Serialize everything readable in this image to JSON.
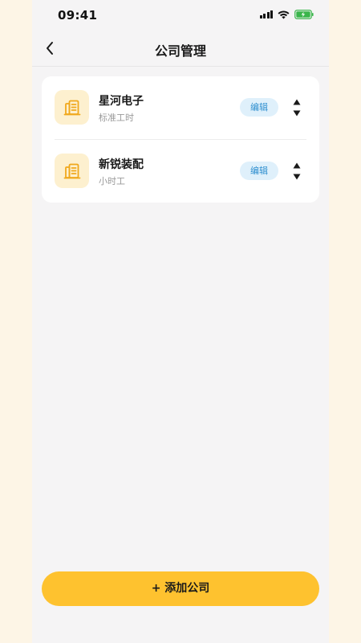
{
  "status_bar": {
    "time": "09:41"
  },
  "header": {
    "title": "公司管理"
  },
  "companies": [
    {
      "name": "星河电子",
      "type": "标准工时",
      "edit_label": "编辑"
    },
    {
      "name": "新锐装配",
      "type": "小时工",
      "edit_label": "编辑"
    }
  ],
  "footer": {
    "add_label": "+ 添加公司"
  },
  "colors": {
    "accent": "#fec22f",
    "icon_bg": "#fdf0cf",
    "icon_color": "#f0a81c",
    "edit_bg": "#dff0fb",
    "edit_text": "#2f8fcf",
    "page_bg": "#f5f4f5",
    "outer_bg": "#fdf5e6"
  },
  "icons": {
    "back": "chevron-left-icon",
    "company": "building-icon",
    "move_up": "triangle-up-icon",
    "move_down": "triangle-down-icon"
  }
}
